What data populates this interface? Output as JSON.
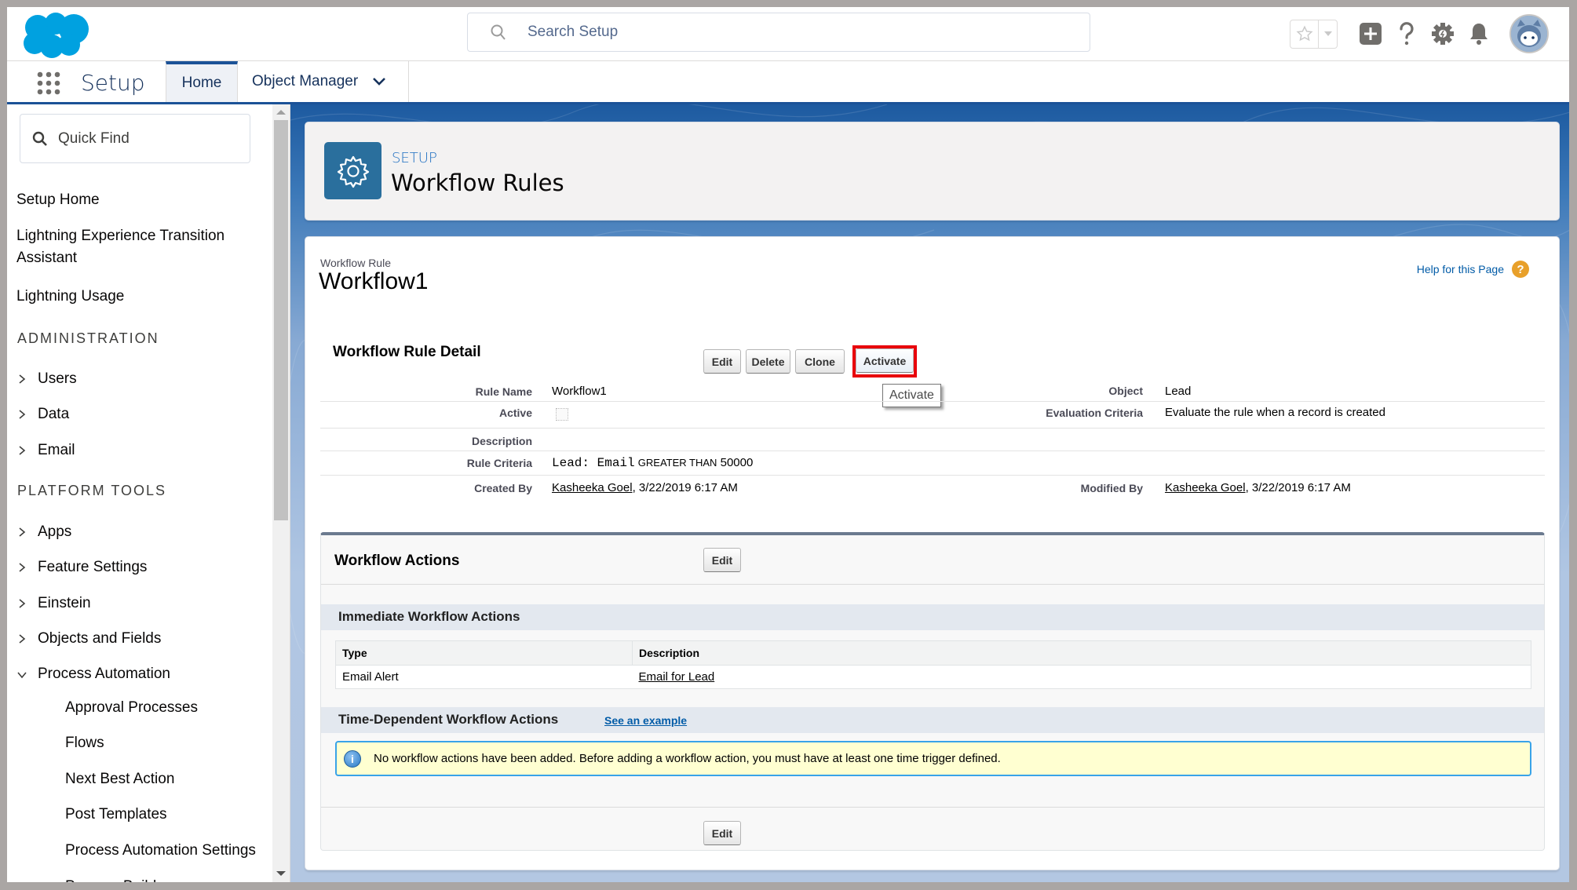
{
  "header": {
    "logo": "salesforce-cloud-logo",
    "search_placeholder": "Search Setup",
    "icons": [
      "star-icon",
      "caret-down-icon",
      "add-icon",
      "help-icon",
      "gear-icon",
      "bell-icon",
      "avatar"
    ]
  },
  "nav": {
    "app_name": "Setup",
    "tabs": [
      {
        "label": "Home",
        "active": true
      },
      {
        "label": "Object Manager",
        "has_dropdown": true
      }
    ]
  },
  "sidebar": {
    "quick_find_placeholder": "Quick Find",
    "top_links": [
      "Setup Home",
      "Lightning Experience Transition Assistant",
      "Lightning Usage"
    ],
    "sections": [
      {
        "title": "ADMINISTRATION",
        "items": [
          "Users",
          "Data",
          "Email"
        ]
      },
      {
        "title": "PLATFORM TOOLS",
        "items": [
          "Apps",
          "Feature Settings",
          "Einstein",
          "Objects and Fields",
          "Process Automation"
        ]
      }
    ],
    "expanded_item": "Process Automation",
    "children": [
      "Approval Processes",
      "Flows",
      "Next Best Action",
      "Post Templates",
      "Process Automation Settings",
      "Process Builder"
    ]
  },
  "page_header": {
    "eyebrow": "SETUP",
    "title": "Workflow Rules"
  },
  "record": {
    "type_label": "Workflow Rule",
    "name": "Workflow1",
    "help_link": "Help for this Page"
  },
  "detail": {
    "title": "Workflow Rule Detail",
    "buttons": [
      "Edit",
      "Delete",
      "Clone",
      "Activate"
    ],
    "tooltip": "Activate",
    "fields": {
      "rule_name_label": "Rule Name",
      "rule_name": "Workflow1",
      "active_label": "Active",
      "active": false,
      "description_label": "Description",
      "description": "",
      "rule_criteria_label": "Rule Criteria",
      "rule_criteria_field": "Lead: Email",
      "rule_criteria_operator": "GREATER THAN",
      "rule_criteria_value": "50000",
      "created_by_label": "Created By",
      "created_by_user": "Kasheeka Goel",
      "created_by_date": ", 3/22/2019 6:17 AM",
      "object_label": "Object",
      "object": "Lead",
      "evaluation_label": "Evaluation Criteria",
      "evaluation": "Evaluate the rule when a record is created",
      "modified_by_label": "Modified By",
      "modified_by_user": "Kasheeka Goel",
      "modified_by_date": ", 3/22/2019 6:17 AM"
    }
  },
  "workflow_actions": {
    "title": "Workflow Actions",
    "edit_label": "Edit",
    "immediate": {
      "title": "Immediate Workflow Actions",
      "columns": [
        "Type",
        "Description"
      ],
      "rows": [
        {
          "type": "Email Alert",
          "description": "Email for Lead"
        }
      ]
    },
    "time_dependent": {
      "title": "Time-Dependent Workflow Actions",
      "example_link": "See an example",
      "info_message": "No workflow actions have been added. Before adding a workflow action, you must have at least one time trigger defined."
    },
    "footer_edit_label": "Edit"
  },
  "colors": {
    "brand_blue": "#1b5297",
    "salesforce_cloud": "#00a1e0",
    "highlight_red": "#e8000b",
    "info_yellow": "#ffffd1",
    "help_orange": "#e8a02a"
  }
}
